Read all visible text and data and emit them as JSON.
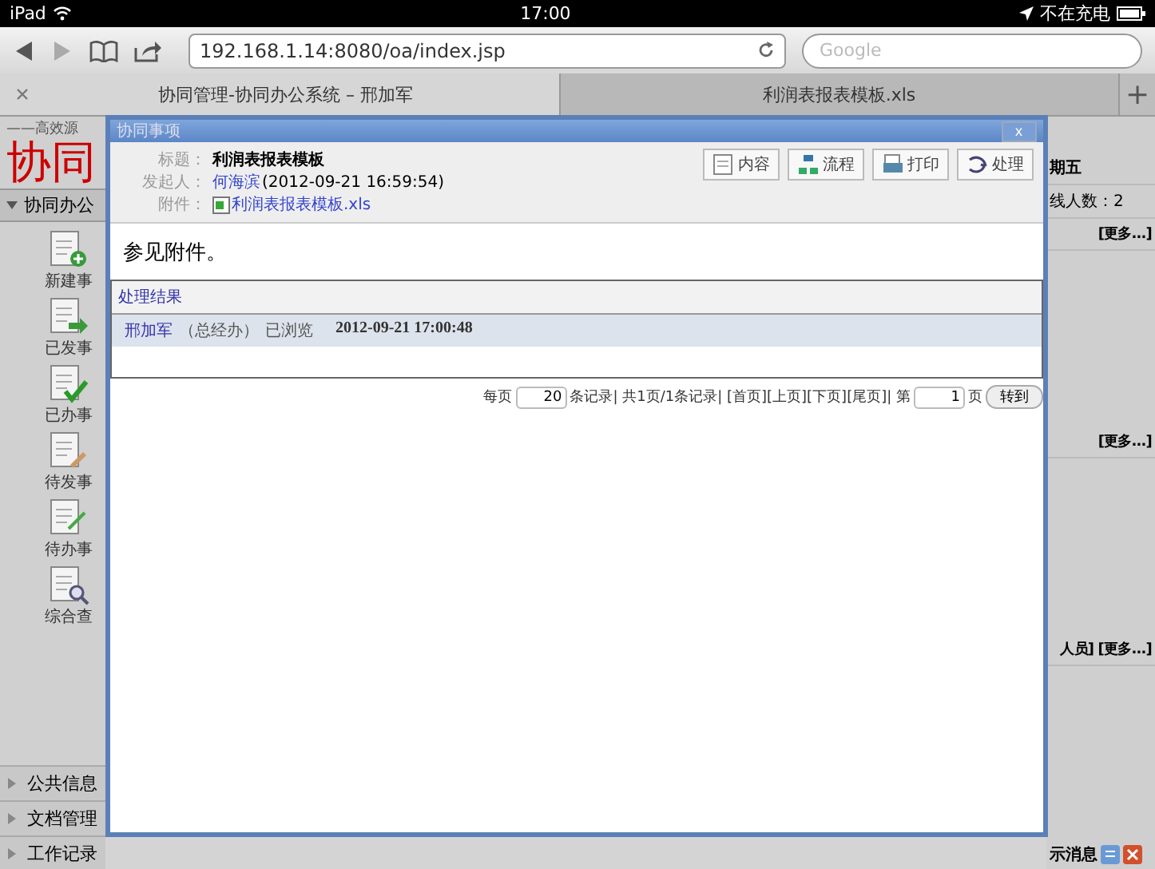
{
  "status_bar": {
    "device": "iPad",
    "time": "17:00",
    "charging": "不在充电"
  },
  "browser": {
    "url": "192.168.1.14:8080/oa/index.jsp",
    "search_placeholder": "Google",
    "tabs": [
      {
        "title": "协同管理-协同办公系统 – 邢加军",
        "selected": true,
        "closable": true
      },
      {
        "title": "利润表报表模板.xls",
        "selected": false,
        "closable": false
      }
    ],
    "new_tab": "+"
  },
  "sidebar": {
    "slogan": "——高效源",
    "logo": "协同",
    "section": {
      "title": "协同办公",
      "expanded": true
    },
    "items": [
      {
        "label": "新建事",
        "kind": "add"
      },
      {
        "label": "已发事",
        "kind": "send"
      },
      {
        "label": "已办事",
        "kind": "done"
      },
      {
        "label": "待发事",
        "kind": "draft"
      },
      {
        "label": "待办事",
        "kind": "todo"
      },
      {
        "label": "综合查",
        "kind": "search"
      }
    ],
    "bottom_sections": [
      {
        "label": "公共信息",
        "expanded": false
      },
      {
        "label": "文档管理",
        "expanded": false
      },
      {
        "label": "工作记录",
        "expanded": false
      }
    ]
  },
  "right_panel": {
    "date": "期五",
    "online": "线人数：2",
    "links": [
      "[更多...]",
      "[更多...]",
      "人员] [更多...]"
    ],
    "message": "示消息"
  },
  "dialog": {
    "title": "协同事项",
    "close": "x",
    "fields": [
      {
        "label": "标题：",
        "value": "利润表报表模板",
        "kind": "title"
      },
      {
        "label": "发起人：",
        "value": "何海滨",
        "extra": "(2012-09-21 16:59:54)",
        "kind": "person"
      },
      {
        "label": "附件：",
        "value": "利润表报表模板.xls",
        "kind": "file"
      }
    ],
    "buttons": [
      {
        "label": "内容",
        "kind": "content"
      },
      {
        "label": "流程",
        "kind": "flow"
      },
      {
        "label": "打印",
        "kind": "print"
      },
      {
        "label": "处理",
        "kind": "handle"
      }
    ],
    "body": "参见附件。",
    "results": {
      "heading": "处理结果",
      "rows": [
        {
          "name": "邢加军",
          "dept": "（总经办）",
          "action": "已浏览",
          "time": "2012-09-21 17:00:48",
          "selected": true
        }
      ]
    },
    "pagination": {
      "per_page_label": "每页",
      "per_page": "20",
      "info": "条记录| 共1页/1条记录| [首页][上页][下页][尾页]| 第",
      "page": "1",
      "page_label": "页",
      "go": "转到"
    }
  }
}
